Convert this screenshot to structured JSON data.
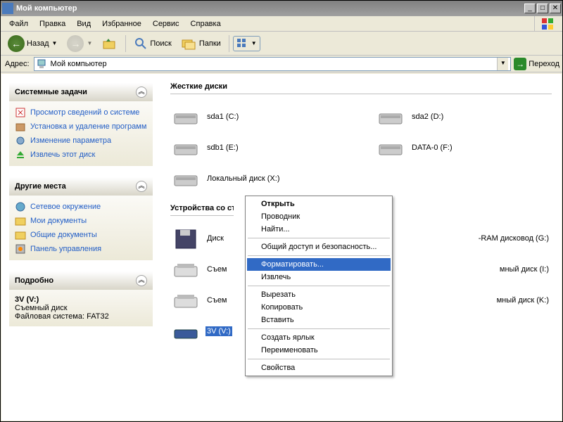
{
  "titlebar": {
    "title": "Мой компьютер"
  },
  "menubar": {
    "file": "Файл",
    "edit": "Правка",
    "view": "Вид",
    "favorites": "Избранное",
    "tools": "Сервис",
    "help": "Справка"
  },
  "toolbar": {
    "back": "Назад",
    "search": "Поиск",
    "folders": "Папки"
  },
  "addressbar": {
    "label": "Адрес:",
    "value": "Мой компьютер",
    "go": "Переход"
  },
  "sidebar": {
    "tasks": {
      "title": "Системные задачи",
      "items": [
        {
          "label": "Просмотр сведений о системе"
        },
        {
          "label": "Установка и удаление программ"
        },
        {
          "label": "Изменение параметра"
        },
        {
          "label": "Извлечь этот диск"
        }
      ]
    },
    "other": {
      "title": "Другие места",
      "items": [
        {
          "label": "Сетевое окружение"
        },
        {
          "label": "Мои документы"
        },
        {
          "label": "Общие документы"
        },
        {
          "label": "Панель управления"
        }
      ]
    },
    "details": {
      "title": "Подробно",
      "name": "3V (V:)",
      "type": "Съемный диск",
      "fs": "Файловая система: FAT32"
    }
  },
  "main": {
    "section_hdd": "Жесткие диски",
    "section_removable": "Устройства со съемными носителями",
    "hdd": [
      {
        "label": "sda1 (C:)"
      },
      {
        "label": "sda2 (D:)"
      },
      {
        "label": "sdb1 (E:)"
      },
      {
        "label": "DATA-0 (F:)"
      },
      {
        "label": "Локальный диск (X:)"
      }
    ],
    "removable": [
      {
        "label": "Диск"
      },
      {
        "label_suffix": "-RAM дисковод (G:)"
      },
      {
        "label": "Съем"
      },
      {
        "label_suffix": "мный диск (I:)"
      },
      {
        "label": "Съем"
      },
      {
        "label_suffix": "мный диск (K:)"
      },
      {
        "label": "3V (V:)"
      }
    ]
  },
  "context_menu": {
    "open": "Открыть",
    "explorer": "Проводник",
    "find": "Найти...",
    "sharing": "Общий доступ и безопасность...",
    "format": "Форматировать...",
    "eject": "Извлечь",
    "cut": "Вырезать",
    "copy": "Копировать",
    "paste": "Вставить",
    "shortcut": "Создать ярлык",
    "rename": "Переименовать",
    "properties": "Свойства"
  }
}
